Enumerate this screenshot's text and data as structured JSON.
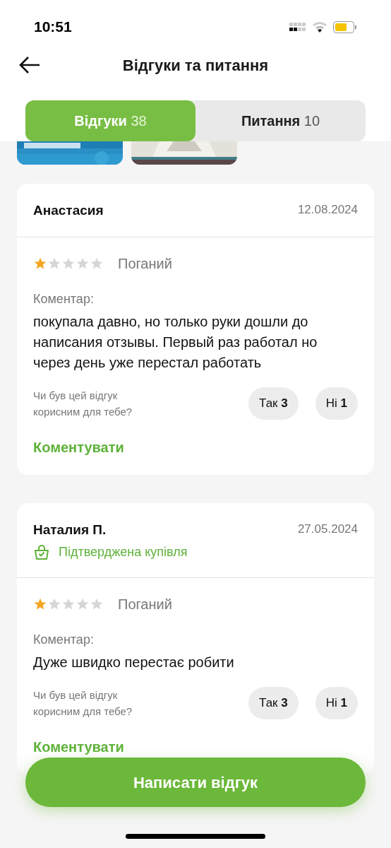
{
  "status_bar": {
    "time": "10:51"
  },
  "header": {
    "title": "Відгуки та питання"
  },
  "tabs": [
    {
      "label": "Відгуки",
      "count": "38",
      "selected": true
    },
    {
      "label": "Питання",
      "count": "10",
      "selected": false
    }
  ],
  "reviews": [
    {
      "name": "Анастасия",
      "date": "12.08.2024",
      "verified": false,
      "stars": 1,
      "rating_label": "Поганий",
      "comment_label": "Коментар:",
      "comment": "покупала давно, но только руки дошли до написания отзывы.  Первый раз работал но через день уже перестал работать",
      "helpful_question": "Чи був цей відгук корисним для тебе?",
      "yes": {
        "label": "Так",
        "count": "3"
      },
      "no": {
        "label": "Ні",
        "count": "1"
      },
      "comment_link": "Коментувати"
    },
    {
      "name": "Наталия П.",
      "date": "27.05.2024",
      "verified": true,
      "verified_label": "Підтверджена купівля",
      "stars": 1,
      "rating_label": "Поганий",
      "comment_label": "Коментар:",
      "comment": "Дуже швидко перестає робити",
      "helpful_question": "Чи був цей відгук корисним для тебе?",
      "yes": {
        "label": "Так",
        "count": "3"
      },
      "no": {
        "label": "Ні",
        "count": "1"
      },
      "comment_link": "Коментувати"
    }
  ],
  "write_button": {
    "label": "Написати відгук"
  }
}
